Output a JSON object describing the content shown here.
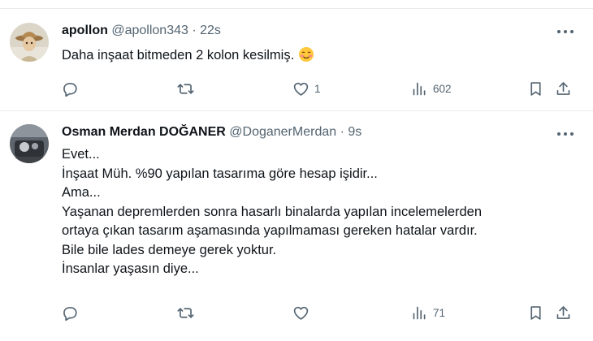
{
  "tweets": [
    {
      "name": "apollon",
      "handle": "@apollon343",
      "separator": "·",
      "time": "22s",
      "text_lines": [
        "Daha inşaat bitmeden 2 kolon kesilmiş."
      ],
      "emoji": "smiling-face-with-blush-emoji",
      "actions": {
        "replies": "",
        "reposts": "",
        "likes": "1",
        "views": "602"
      }
    },
    {
      "name": "Osman Merdan DOĞANER",
      "handle": "@DoganerMerdan",
      "separator": "·",
      "time": "9s",
      "text_lines": [
        "Evet...",
        "İnşaat Müh. %90 yapılan tasarıma göre hesap işidir...",
        "Ama...",
        "Yaşanan depremlerden sonra hasarlı binalarda yapılan incelemelerden",
        "ortaya çıkan tasarım aşamasında yapılmaması gereken hatalar vardır.",
        "Bile bile lades demeye gerek yoktur.",
        "İnsanlar yaşasın diye..."
      ],
      "actions": {
        "replies": "",
        "reposts": "",
        "likes": "",
        "views": "71"
      }
    }
  ],
  "icons": [
    "more-icon",
    "reply-icon",
    "repost-icon",
    "like-icon",
    "views-icon",
    "bookmark-icon",
    "share-icon"
  ],
  "colors": {
    "text": "#0f1419",
    "secondary": "#536471",
    "divider": "#e7e9ea",
    "background": "#ffffff"
  }
}
